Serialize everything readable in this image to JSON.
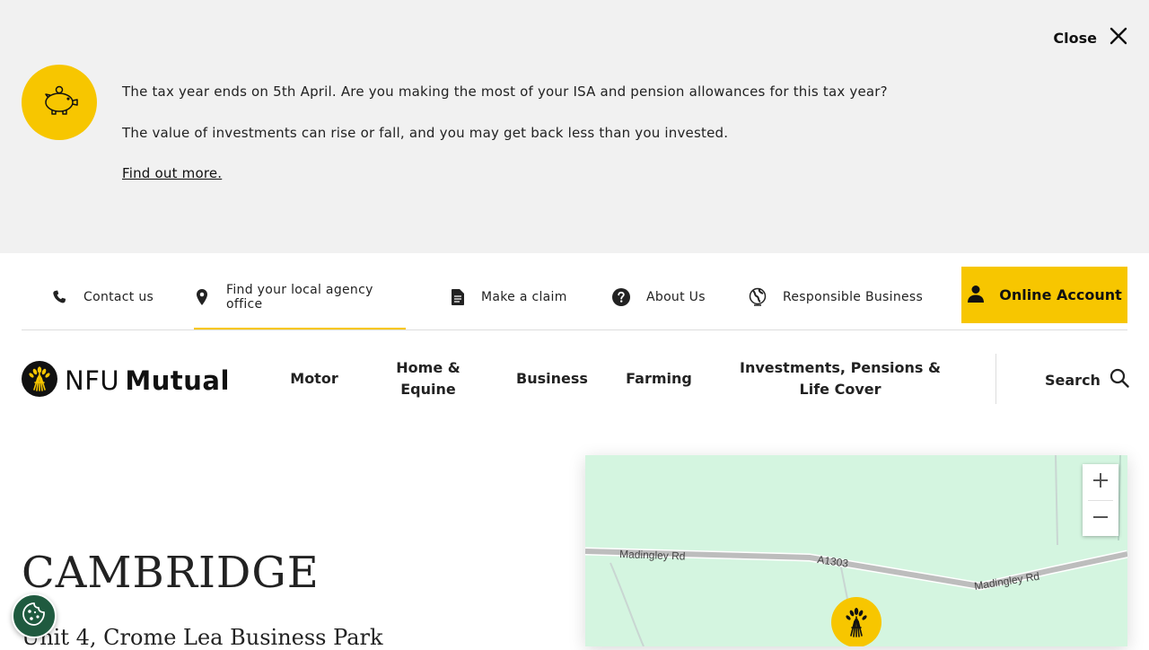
{
  "banner": {
    "close_label": "Close",
    "message_1": "The tax year ends on 5th April. Are you making the most of your ISA and pension allowances for this tax year?",
    "message_2": "The value of investments can rise or fall, and you may get back less than you invested.",
    "link_label": "Find out more."
  },
  "utility_nav": {
    "items": [
      {
        "label": "Contact us",
        "icon": "phone-icon"
      },
      {
        "label": "Find your local agency office",
        "icon": "map-pin-icon"
      },
      {
        "label": "Make a claim",
        "icon": "document-icon"
      },
      {
        "label": "About Us",
        "icon": "question-icon"
      },
      {
        "label": "Responsible Business",
        "icon": "globe-icon"
      }
    ],
    "online_account_label": "Online Account"
  },
  "logo": {
    "text_light": "NFU",
    "text_bold": "Mutual"
  },
  "main_nav": {
    "items": [
      {
        "label": "Motor"
      },
      {
        "label": "Home & Equine"
      },
      {
        "label": "Business"
      },
      {
        "label": "Farming"
      },
      {
        "label": "Investments, Pensions & Life Cover"
      }
    ],
    "search_label": "Search"
  },
  "content": {
    "title": "CAMBRIDGE",
    "address_line_1": "Unit 4, Crome Lea Business Park"
  },
  "map": {
    "zoom_in": "+",
    "zoom_out": "−",
    "road_labels": [
      "Madingley Rd",
      "A1303",
      "Madingley Rd"
    ]
  },
  "colors": {
    "brand_yellow": "#f7c600",
    "banner_bg": "#f1f1f1",
    "map_bg": "#d4f5e0",
    "cookie_green": "#1f5a3f"
  }
}
